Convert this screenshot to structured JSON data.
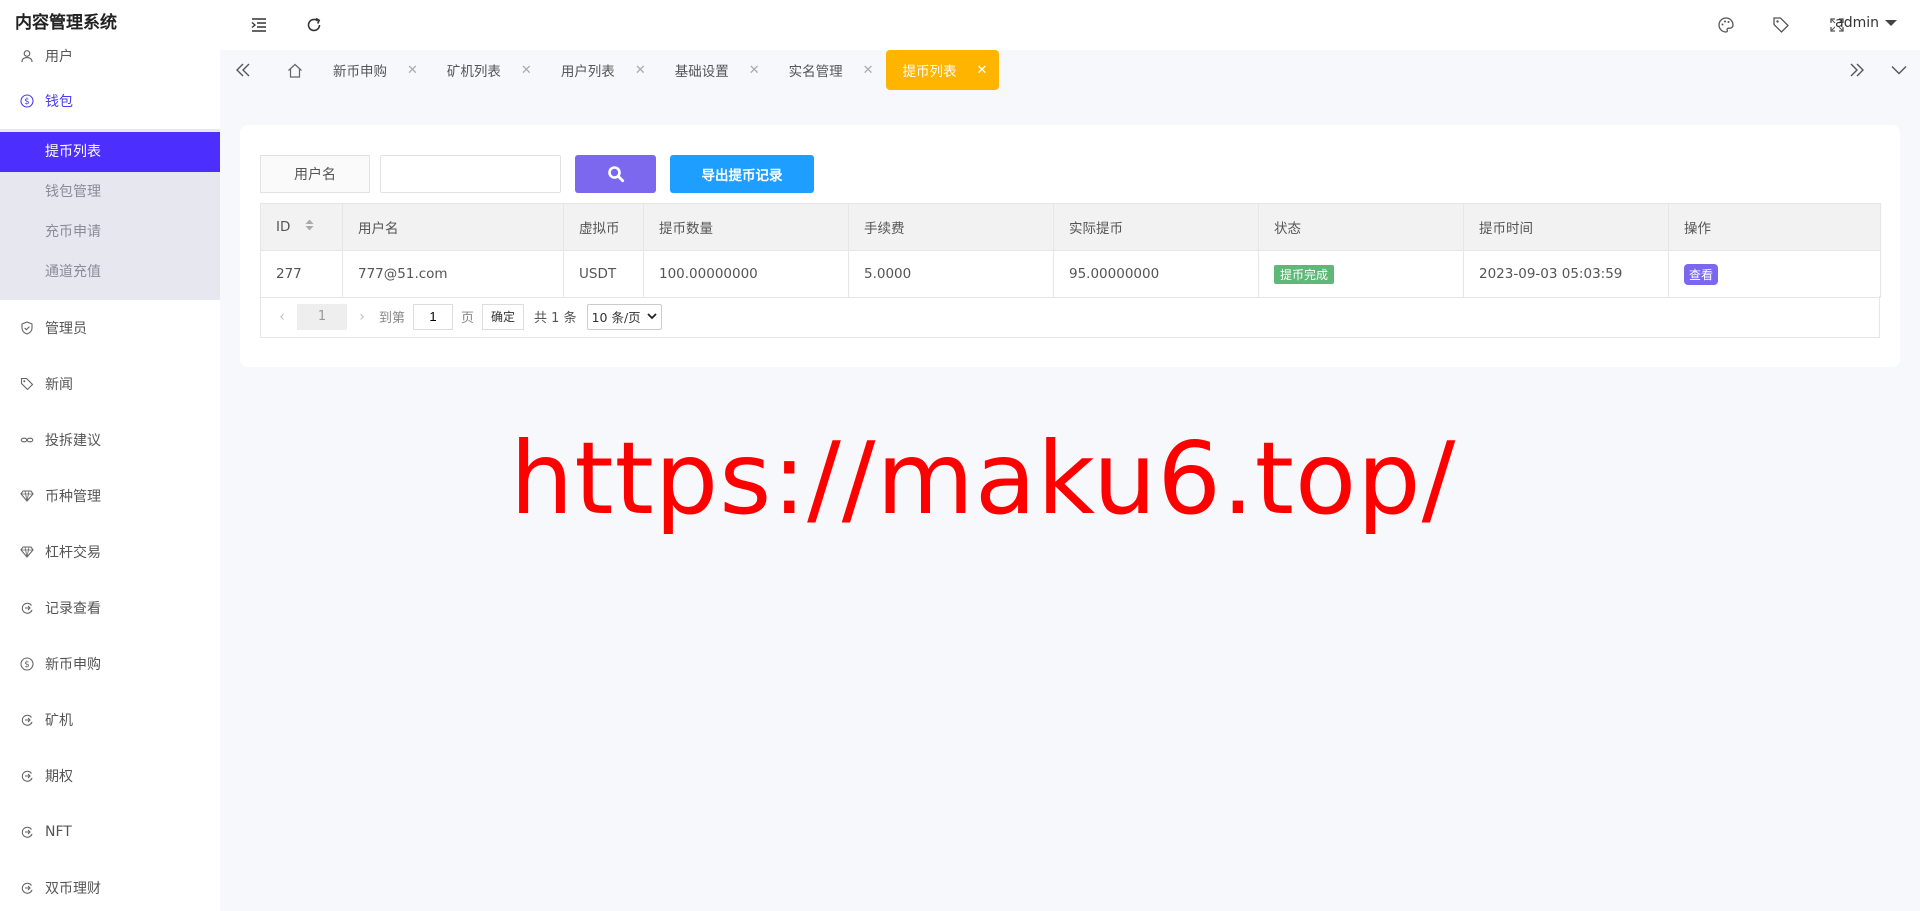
{
  "app": {
    "title": "内容管理系统"
  },
  "header": {
    "user": "admin"
  },
  "sidebar": {
    "items": [
      {
        "label": "用户",
        "icon": "user-icon"
      },
      {
        "label": "钱包",
        "icon": "dollar-circle-icon"
      },
      {
        "label": "管理员",
        "icon": "shield-icon"
      },
      {
        "label": "新闻",
        "icon": "tag-icon"
      },
      {
        "label": "投拆建议",
        "icon": "link-icon"
      },
      {
        "label": "币种管理",
        "icon": "diamond-icon"
      },
      {
        "label": "杠杆交易",
        "icon": "diamond-icon"
      },
      {
        "label": "记录查看",
        "icon": "circle-arrow-icon"
      },
      {
        "label": "新币申购",
        "icon": "dollar-circle-icon"
      },
      {
        "label": "矿机",
        "icon": "circle-arrow-icon"
      },
      {
        "label": "期权",
        "icon": "circle-arrow-icon"
      },
      {
        "label": "NFT",
        "icon": "circle-arrow-icon"
      },
      {
        "label": "双币理财",
        "icon": "circle-arrow-icon"
      }
    ],
    "wallet_sub": [
      "提币列表",
      "钱包管理",
      "充币申请",
      "通道充值"
    ]
  },
  "tabs": [
    "新币申购",
    "矿机列表",
    "用户列表",
    "基础设置",
    "实名管理",
    "提币列表"
  ],
  "search": {
    "label": "用户名",
    "value": "",
    "export_label": "导出提币记录"
  },
  "table": {
    "headers": [
      "ID",
      "用户名",
      "虚拟币",
      "提币数量",
      "手续费",
      "实际提币",
      "状态",
      "提币时间",
      "操作"
    ],
    "rows": [
      {
        "id": "277",
        "username": "777@51.com",
        "coin": "USDT",
        "amount": "100.00000000",
        "fee": "5.0000",
        "actual": "95.00000000",
        "status": "提币完成",
        "time": "2023-09-03 05:03:59",
        "action": "查看"
      }
    ]
  },
  "pager": {
    "current": "1",
    "goto_label": "到第",
    "goto_value": "1",
    "page_unit": "页",
    "confirm": "确定",
    "total": "共 1 条",
    "page_size": "10 条/页"
  },
  "watermark": "https://maku6.top/",
  "colors": {
    "accent": "#4c2fff",
    "active_tab": "#ffb400",
    "search_button": "#7b68ee",
    "export_button": "#1e9fff",
    "status_badge": "#5fb878",
    "watermark": "#ff0000"
  }
}
